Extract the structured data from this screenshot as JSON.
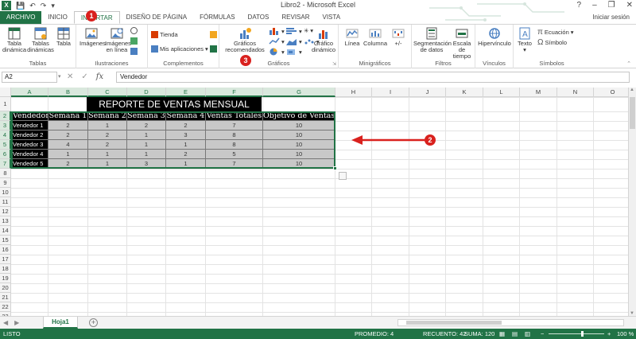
{
  "window": {
    "title": "Libro2 - Microsoft Excel",
    "app_logo": "X",
    "controls": [
      "?",
      "–",
      "❐",
      "✕"
    ],
    "login": "Iniciar sesión"
  },
  "tabs": [
    "ARCHIVO",
    "INICIO",
    "INSERTAR",
    "DISEÑO DE PÁGINA",
    "FÓRMULAS",
    "DATOS",
    "REVISAR",
    "VISTA"
  ],
  "active_tab": "INSERTAR",
  "ribbon": {
    "groups": {
      "tablas": "Tablas",
      "ilustraciones": "Ilustraciones",
      "complementos": "Complementos",
      "graficos": "Gráficos",
      "minigraficos": "Minigráficos",
      "filtros": "Filtros",
      "vinculos": "Vínculos",
      "simbolos": "Símbolos"
    },
    "buttons": {
      "tabla_dinamica_1": "Tabla",
      "tabla_dinamica_2": "dinámica",
      "tablas_dinamicas_1": "Tablas",
      "tablas_dinamicas_2": "dinámicas",
      "tabla": "Tabla",
      "imagenes": "Imágenes",
      "imagenes_linea_1": "Imágenes",
      "imagenes_linea_2": "en línea",
      "tienda": "Tienda",
      "mis_aplicaciones": "Mis aplicaciones",
      "graficos_recomendados_1": "Gráficos",
      "graficos_recomendados_2": "recomendados",
      "grafico_dinamico_1": "Gráfico",
      "grafico_dinamico_2": "dinámico",
      "linea": "Línea",
      "columna": "Columna",
      "ganancia_perdida": "+/-",
      "segmentacion_1": "Segmentación",
      "segmentacion_2": "de datos",
      "escala_1": "Escala de",
      "escala_2": "tiempo",
      "hipervinculo": "Hipervínculo",
      "texto": "Texto",
      "ecuacion": "Ecuación",
      "simbolo": "Símbolo"
    }
  },
  "formula_bar": {
    "name_box": "A2",
    "cancel": "✕",
    "enter": "✓",
    "fx": "fx",
    "content": "Vendedor"
  },
  "columns": [
    "A",
    "B",
    "C",
    "D",
    "E",
    "F",
    "G",
    "H",
    "I",
    "J",
    "K",
    "L",
    "M",
    "N",
    "O"
  ],
  "rows": [
    "1",
    "2",
    "3",
    "4",
    "5",
    "6",
    "7",
    "8",
    "9",
    "10",
    "11",
    "12",
    "13",
    "14",
    "15",
    "16",
    "17",
    "18",
    "19",
    "20",
    "21",
    "22",
    "23"
  ],
  "sheet": {
    "title": "REPORTE DE VENTAS MENSUAL",
    "headers": [
      "Vendedor",
      "Semana 1",
      "Semana 2",
      "Semana 3",
      "Semana 4",
      "Ventas Totales",
      "Objetivo de Ventas"
    ],
    "data": [
      [
        "Vendedor 1",
        "2",
        "1",
        "2",
        "2",
        "7",
        "10"
      ],
      [
        "Vendedor 2",
        "2",
        "2",
        "1",
        "3",
        "8",
        "10"
      ],
      [
        "Vendedor 3",
        "4",
        "2",
        "1",
        "1",
        "8",
        "10"
      ],
      [
        "Vendedor 4",
        "1",
        "1",
        "1",
        "2",
        "5",
        "10"
      ],
      [
        "Vendedor 5",
        "2",
        "1",
        "3",
        "1",
        "7",
        "10"
      ]
    ]
  },
  "sheet_tabs": {
    "active": "Hoja1",
    "add": "+",
    "nav_prev": "◀",
    "nav_next": "▶"
  },
  "status": {
    "ready": "LISTO",
    "promedio": "PROMEDIO: 4",
    "recuento": "RECUENTO: 42",
    "suma": "SUMA: 120",
    "zoom_minus": "−",
    "zoom_plus": "+",
    "zoom": "100 %"
  },
  "annotations": [
    "1",
    "2",
    "3"
  ],
  "colors": {
    "excel_green": "#217346",
    "annotation_red": "#d9211e",
    "table_grey": "#c8c8c8"
  }
}
